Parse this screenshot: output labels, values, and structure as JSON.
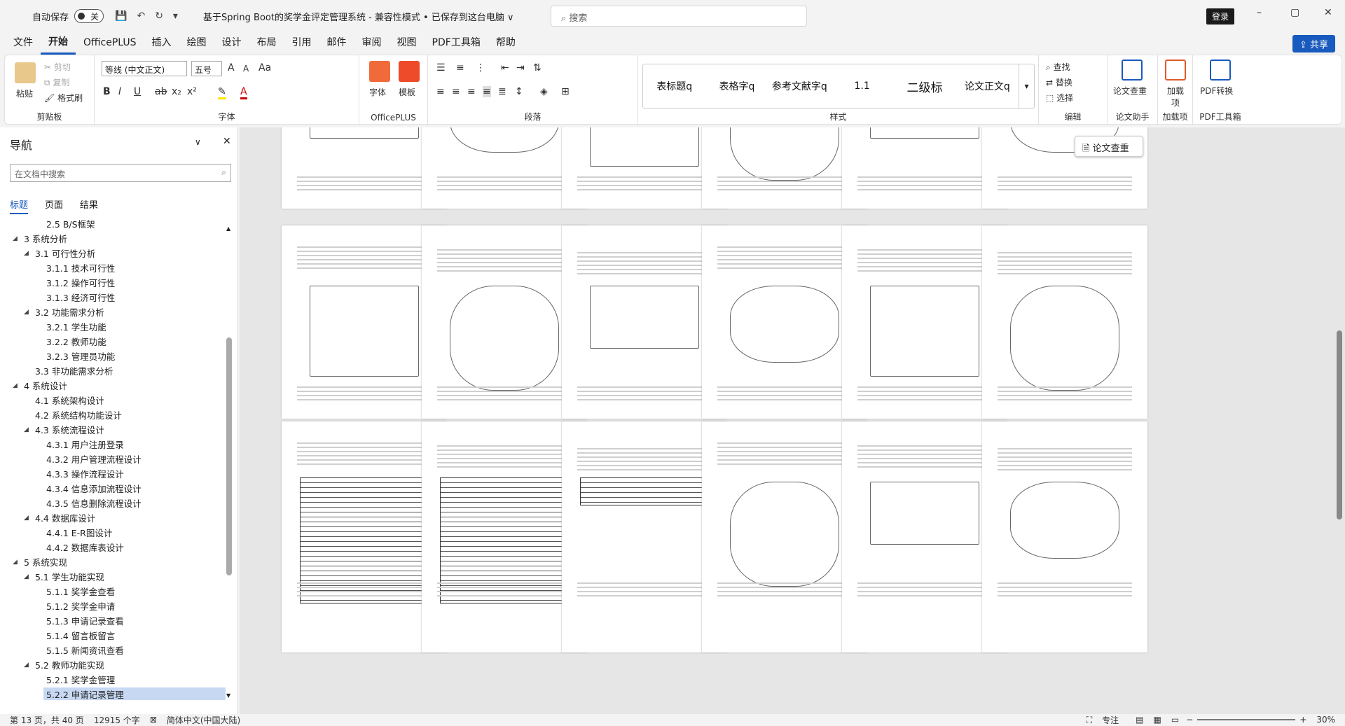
{
  "titlebar": {
    "autosave_label": "自动保存",
    "autosave_state": "关",
    "document_title": "基于Spring Boot的奖学金评定管理系统  -  兼容性模式 • 已保存到这台电脑 ∨",
    "search_placeholder": "搜索",
    "login_label": "登录",
    "minimize": "–",
    "restore": "▢",
    "close": "✕"
  },
  "menu": {
    "items": [
      "文件",
      "开始",
      "OfficePLUS",
      "插入",
      "绘图",
      "设计",
      "布局",
      "引用",
      "邮件",
      "审阅",
      "视图",
      "PDF工具箱",
      "帮助"
    ],
    "active": "开始",
    "share_label": "共享"
  },
  "ribbon": {
    "clipboard": {
      "paste": "粘贴",
      "cut": "剪切",
      "copy": "复制",
      "format_painter": "格式刷",
      "label": "剪贴板"
    },
    "font": {
      "font_name": "等线 (中文正文)",
      "font_size": "五号",
      "label": "字体",
      "btn_a": "A",
      "btn_aa": "Aa"
    },
    "officeplus": {
      "font_btn": "字体",
      "template_btn": "模板",
      "label": "OfficePLUS"
    },
    "paragraph": {
      "label": "段落"
    },
    "styles": {
      "items": [
        "表标题q",
        "表格字q",
        "参考文献字q",
        "1.1",
        "二级标",
        "论文正文q"
      ],
      "label": "样式"
    },
    "editing": {
      "find": "查找",
      "replace": "替换",
      "select": "选择",
      "label": "编辑"
    },
    "paper_check": {
      "btn": "论文查重",
      "label": "论文助手"
    },
    "addins": {
      "btn": "加载项",
      "label": "加载项"
    },
    "pdf": {
      "btn": "PDF转换",
      "label": "PDF工具箱"
    }
  },
  "nav_pane": {
    "title": "导航",
    "search_placeholder": "在文档中搜索",
    "tabs": [
      "标题",
      "页面",
      "结果"
    ],
    "active_tab": "标题",
    "tree": [
      {
        "text": "2.5  B/S框架",
        "level": 2,
        "arrow": false
      },
      {
        "text": "3 系统分析",
        "level": 0,
        "arrow": true
      },
      {
        "text": "3.1 可行性分析",
        "level": 1,
        "arrow": true
      },
      {
        "text": "3.1.1 技术可行性",
        "level": 2,
        "arrow": false
      },
      {
        "text": "3.1.2 操作可行性",
        "level": 2,
        "arrow": false
      },
      {
        "text": "3.1.3 经济可行性",
        "level": 2,
        "arrow": false
      },
      {
        "text": "3.2 功能需求分析",
        "level": 1,
        "arrow": true
      },
      {
        "text": "3.2.1 学生功能",
        "level": 2,
        "arrow": false
      },
      {
        "text": "3.2.2 教师功能",
        "level": 2,
        "arrow": false
      },
      {
        "text": "3.2.3 管理员功能",
        "level": 2,
        "arrow": false
      },
      {
        "text": "3.3 非功能需求分析",
        "level": 1,
        "arrow": false
      },
      {
        "text": "4 系统设计",
        "level": 0,
        "arrow": true
      },
      {
        "text": "4.1 系统架构设计",
        "level": 1,
        "arrow": false
      },
      {
        "text": "4.2 系统结构功能设计",
        "level": 1,
        "arrow": false
      },
      {
        "text": "4.3 系统流程设计",
        "level": 1,
        "arrow": true
      },
      {
        "text": "4.3.1 用户注册登录",
        "level": 2,
        "arrow": false
      },
      {
        "text": "4.3.2 用户管理流程设计",
        "level": 2,
        "arrow": false
      },
      {
        "text": "4.3.3 操作流程设计",
        "level": 2,
        "arrow": false
      },
      {
        "text": "4.3.4 信息添加流程设计",
        "level": 2,
        "arrow": false
      },
      {
        "text": "4.3.5 信息删除流程设计",
        "level": 2,
        "arrow": false
      },
      {
        "text": "4.4 数据库设计",
        "level": 1,
        "arrow": true
      },
      {
        "text": "4.4.1 E-R图设计",
        "level": 2,
        "arrow": false
      },
      {
        "text": "4.4.2 数据库表设计",
        "level": 2,
        "arrow": false
      },
      {
        "text": "5 系统实现",
        "level": 0,
        "arrow": true
      },
      {
        "text": "5.1 学生功能实现",
        "level": 1,
        "arrow": true
      },
      {
        "text": "5.1.1 奖学金查看",
        "level": 2,
        "arrow": false
      },
      {
        "text": "5.1.2 奖学金申请",
        "level": 2,
        "arrow": false
      },
      {
        "text": "5.1.3 申请记录查看",
        "level": 2,
        "arrow": false
      },
      {
        "text": "5.1.4 留言板留言",
        "level": 2,
        "arrow": false
      },
      {
        "text": "5.1.5 新闻资讯查看",
        "level": 2,
        "arrow": false
      },
      {
        "text": "5.2 教师功能实现",
        "level": 1,
        "arrow": true
      },
      {
        "text": "5.2.1 奖学金管理",
        "level": 2,
        "arrow": false
      },
      {
        "text": "5.2.2 申请记录管理",
        "level": 2,
        "arrow": false,
        "selected": true
      }
    ]
  },
  "floating": {
    "paper_check": "论文查重"
  },
  "statusbar": {
    "page": "第 13 页，共 40 页",
    "words": "12915 个字",
    "language": "简体中文(中国大陆)",
    "focus": "专注",
    "zoom": "30%"
  },
  "colors": {
    "accent": "#185abd",
    "selected": "#c7d8f3"
  }
}
